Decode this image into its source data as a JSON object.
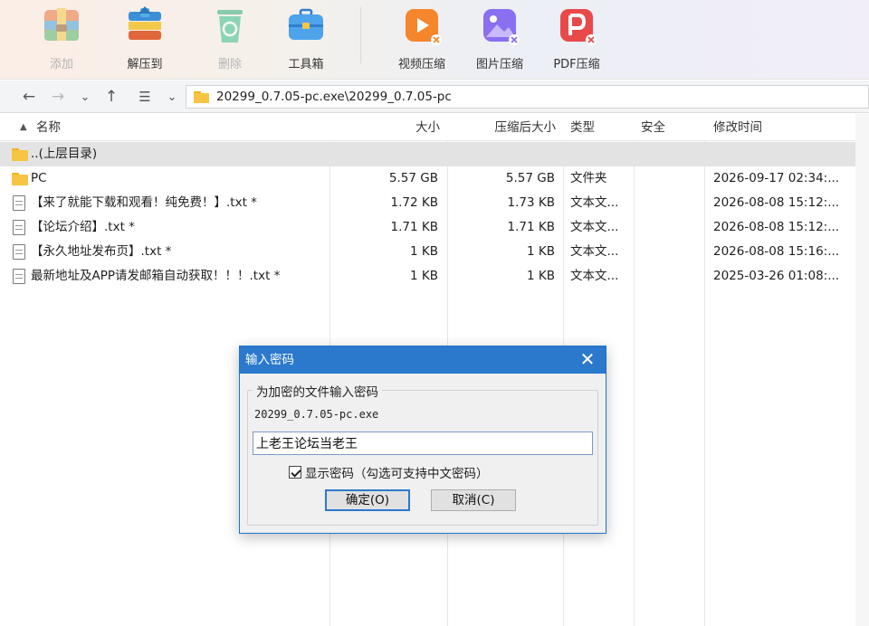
{
  "toolbar": {
    "items": [
      {
        "label": "添加",
        "icon": "add-archive-icon",
        "enabled": false
      },
      {
        "label": "解压到",
        "icon": "extract-to-icon",
        "enabled": true
      },
      {
        "label": "删除",
        "icon": "recycle-bin-icon",
        "enabled": false
      },
      {
        "label": "工具箱",
        "icon": "toolbox-icon",
        "enabled": true
      },
      {
        "label": "视频压缩",
        "icon": "video-compress-icon",
        "enabled": true
      },
      {
        "label": "图片压缩",
        "icon": "image-compress-icon",
        "enabled": true
      },
      {
        "label": "PDF压缩",
        "icon": "pdf-compress-icon",
        "enabled": true
      }
    ]
  },
  "address": {
    "path": "20299_0.7.05-pc.exe\\20299_0.7.05-pc"
  },
  "columns": {
    "name": "名称",
    "size": "大小",
    "packed": "压缩后大小",
    "type": "类型",
    "security": "安全",
    "modified": "修改时间"
  },
  "rows": [
    {
      "name": "..(上层目录)",
      "size": "",
      "packed": "",
      "type": "",
      "modified": "",
      "kind": "parent"
    },
    {
      "name": "PC",
      "size": "5.57 GB",
      "packed": "5.57 GB",
      "type": "文件夹",
      "modified": "2026-09-17 02:34:...",
      "kind": "folder"
    },
    {
      "name": "【来了就能下载和观看！纯免费！】.txt *",
      "size": "1.72 KB",
      "packed": "1.73 KB",
      "type": "文本文...",
      "modified": "2026-08-08 15:12:...",
      "kind": "file"
    },
    {
      "name": "【论坛介绍】.txt *",
      "size": "1.71 KB",
      "packed": "1.71 KB",
      "type": "文本文...",
      "modified": "2026-08-08 15:12:...",
      "kind": "file"
    },
    {
      "name": "【永久地址发布页】.txt *",
      "size": "1 KB",
      "packed": "1 KB",
      "type": "文本文...",
      "modified": "2026-08-08 15:16:...",
      "kind": "file"
    },
    {
      "name": "最新地址及APP请发邮箱自动获取！！！.txt *",
      "size": "1 KB",
      "packed": "1 KB",
      "type": "文本文...",
      "modified": "2025-03-26 01:08:...",
      "kind": "file"
    }
  ],
  "dialog": {
    "title": "输入密码",
    "group_label": "为加密的文件输入密码",
    "filename": "20299_0.7.05-pc.exe",
    "password_value": "上老王论坛当老王",
    "show_password_label": "显示密码（勾选可支持中文密码）",
    "show_password_checked": true,
    "ok_label": "确定(O)",
    "cancel_label": "取消(C)"
  },
  "colors": {
    "accent": "#2b79cc",
    "folder": "#f7c443",
    "selected_row": "#e3e3e3"
  }
}
